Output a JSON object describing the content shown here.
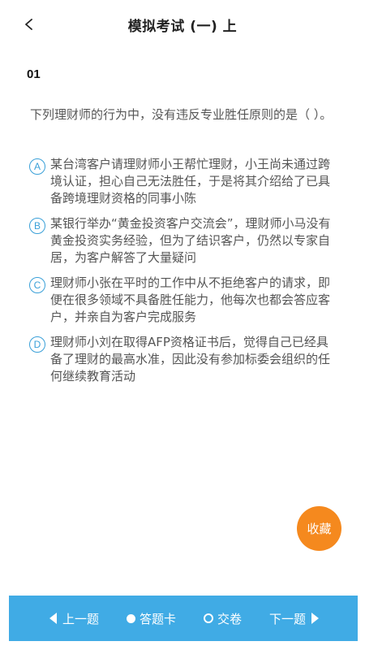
{
  "header": {
    "title": "模拟考试 (一) 上"
  },
  "question": {
    "number": "01",
    "stem": "下列理财师的行为中，没有违反专业胜任原则的是（ ）。",
    "options": [
      {
        "letter": "A",
        "text": "某台湾客户请理财师小王帮忙理财，小王尚未通过跨境认证，担心自己无法胜任，于是将其介绍给了已具备跨境理财资格的同事小陈"
      },
      {
        "letter": "B",
        "text": "某银行举办“黄金投资客户交流会”，理财师小马没有黄金投资实务经验，但为了结识客户，仍然以专家自居，为客户解答了大量疑问"
      },
      {
        "letter": "C",
        "text": "理财师小张在平时的工作中从不拒绝客户的请求，即便在很多领域不具备胜任能力，他每次也都会答应客户，并亲自为客户完成服务"
      },
      {
        "letter": "D",
        "text": "理财师小刘在取得AFP资格证书后，觉得自己已经具备了理财的最高水准，因此没有参加标委会组织的任何继续教育活动"
      }
    ]
  },
  "favorite_label": "收藏",
  "bottom_bar": {
    "prev": "上一题",
    "answer_card": "答题卡",
    "submit": "交卷",
    "next": "下一题"
  },
  "colors": {
    "accent": "#40abe5",
    "option_circle": "#3aa0d8",
    "favorite": "#f5891e"
  }
}
